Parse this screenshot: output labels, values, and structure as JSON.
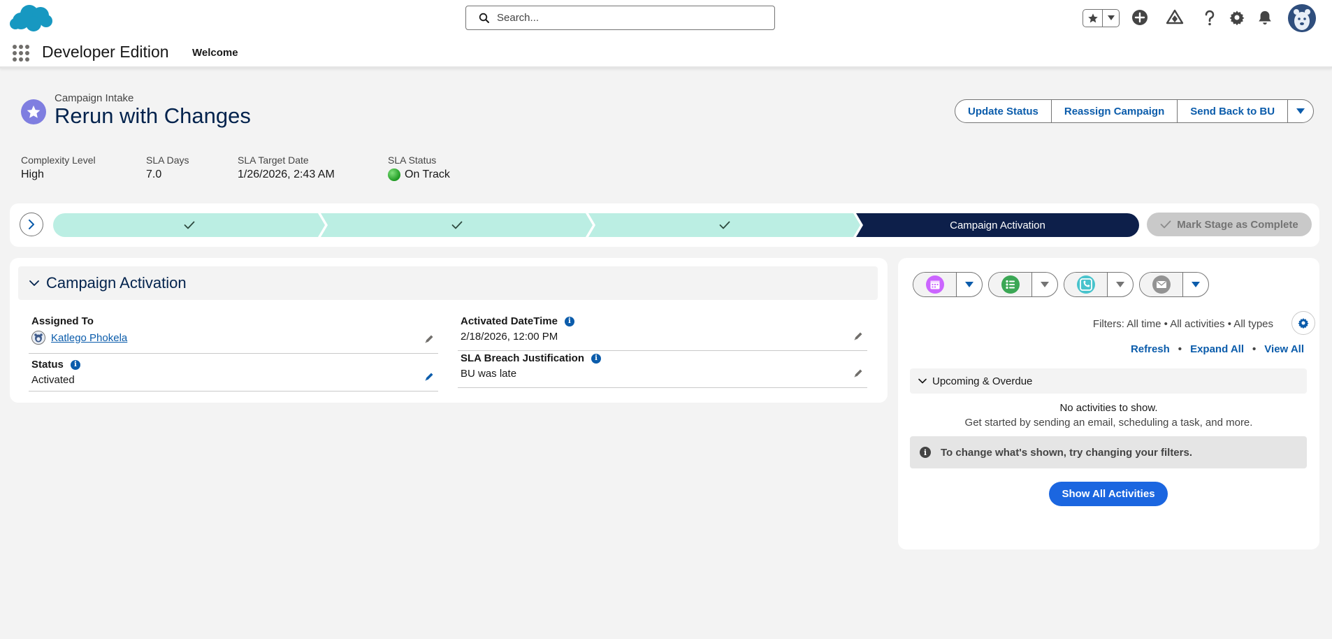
{
  "header": {
    "search_placeholder": "Search...",
    "icons": [
      "salesforce-cloud-logo",
      "search-icon",
      "favorites-star-icon",
      "chevron-down-icon",
      "add-icon",
      "trailhead-icon",
      "help-icon",
      "setup-gear-icon",
      "notifications-bell-icon",
      "user-avatar"
    ]
  },
  "nav": {
    "app_name": "Developer Edition",
    "items": [
      "Welcome"
    ]
  },
  "record": {
    "object_label": "Campaign Intake",
    "title": "Rerun with Changes",
    "actions": [
      "Update Status",
      "Reassign Campaign",
      "Send Back to BU"
    ],
    "highlights": [
      {
        "label": "Complexity Level",
        "value": "High"
      },
      {
        "label": "SLA Days",
        "value": "7.0"
      },
      {
        "label": "SLA Target Date",
        "value": "1/26/2026, 2:43 AM"
      },
      {
        "label": "SLA Status",
        "value": "On Track"
      }
    ]
  },
  "path": {
    "current_stage": "Campaign Activation",
    "completed_stages": 3,
    "mark_complete_label": "Mark Stage as Complete",
    "colors": {
      "complete": "#bbeee3",
      "current": "#0d1f4a"
    }
  },
  "details": {
    "section_title": "Campaign Activation",
    "fields": {
      "assigned_to": {
        "label": "Assigned To",
        "value": "Katlego Phokela"
      },
      "status": {
        "label": "Status",
        "value": "Activated"
      },
      "activated_datetime": {
        "label": "Activated DateTime",
        "value": "2/18/2026, 12:00 PM"
      },
      "sla_breach": {
        "label": "SLA Breach Justification",
        "value": "BU was late"
      }
    }
  },
  "activity": {
    "publishers": [
      "new-event-icon",
      "new-task-icon",
      "log-call-icon",
      "email-icon"
    ],
    "filters_text": "Filters: All time • All activities • All types",
    "links": [
      "Refresh",
      "Expand All",
      "View All"
    ],
    "upcoming_label": "Upcoming & Overdue",
    "empty_line1": "No activities to show.",
    "empty_line2": "Get started by sending an email, scheduling a task, and more.",
    "filter_note": "To change what's shown, try changing your filters.",
    "show_all_label": "Show All Activities"
  }
}
